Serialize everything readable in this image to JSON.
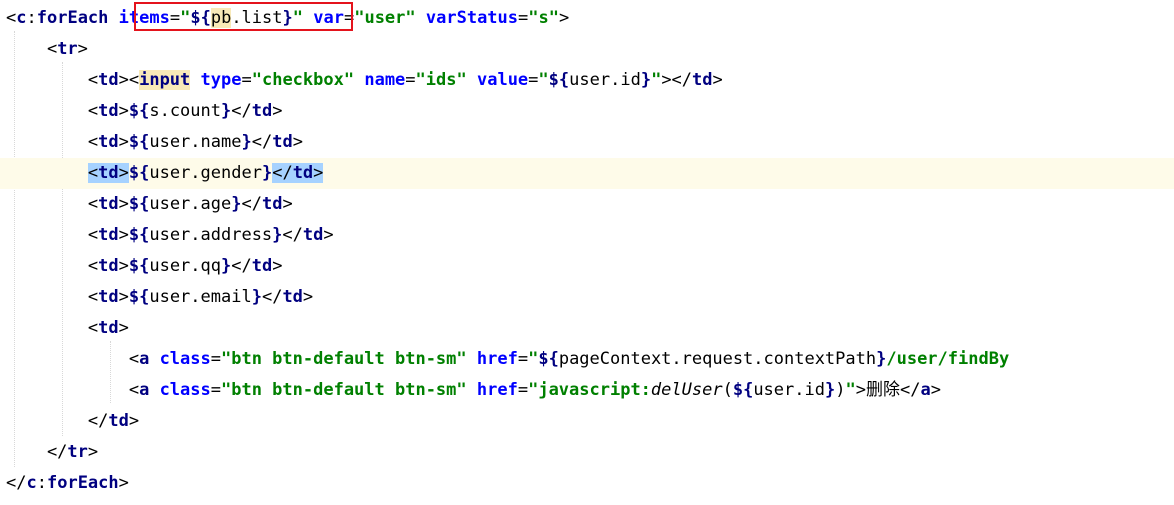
{
  "editor": {
    "highlight_color": "#e4131c",
    "lines": [
      {
        "id": "foreach-open",
        "segments": [
          {
            "t": "<",
            "c": "punct"
          },
          {
            "t": "c",
            "c": "tag"
          },
          {
            "t": ":",
            "c": "punct"
          },
          {
            "t": "forEach",
            "c": "tag"
          },
          {
            "t": " ",
            "c": "punct"
          },
          {
            "t": "items",
            "c": "attr"
          },
          {
            "t": "=",
            "c": "punct"
          },
          {
            "t": "\"",
            "c": "str"
          },
          {
            "t": "${",
            "c": "tag"
          },
          {
            "t": "pb",
            "c": "el",
            "hl": "pb"
          },
          {
            "t": ".list",
            "c": "el"
          },
          {
            "t": "}",
            "c": "tag"
          },
          {
            "t": "\"",
            "c": "str"
          },
          {
            "t": " ",
            "c": "punct"
          },
          {
            "t": "var",
            "c": "attr"
          },
          {
            "t": "=",
            "c": "punct"
          },
          {
            "t": "\"user\"",
            "c": "str"
          },
          {
            "t": " ",
            "c": "punct"
          },
          {
            "t": "varStatus",
            "c": "attr"
          },
          {
            "t": "=",
            "c": "punct"
          },
          {
            "t": "\"s\"",
            "c": "str"
          },
          {
            "t": ">",
            "c": "punct"
          }
        ]
      },
      {
        "id": "tr-open",
        "segments": [
          {
            "t": "    <",
            "c": "punct"
          },
          {
            "t": "tr",
            "c": "tag"
          },
          {
            "t": ">",
            "c": "punct"
          }
        ]
      },
      {
        "id": "td-checkbox",
        "segments": [
          {
            "t": "        <",
            "c": "punct"
          },
          {
            "t": "td",
            "c": "tag"
          },
          {
            "t": "><",
            "c": "punct"
          },
          {
            "t": "input",
            "c": "tag",
            "hl": "pb"
          },
          {
            "t": " ",
            "c": "punct"
          },
          {
            "t": "type",
            "c": "attr"
          },
          {
            "t": "=",
            "c": "punct"
          },
          {
            "t": "\"checkbox\"",
            "c": "str"
          },
          {
            "t": " ",
            "c": "punct"
          },
          {
            "t": "name",
            "c": "attr"
          },
          {
            "t": "=",
            "c": "punct"
          },
          {
            "t": "\"ids\"",
            "c": "str"
          },
          {
            "t": " ",
            "c": "punct"
          },
          {
            "t": "value",
            "c": "attr"
          },
          {
            "t": "=",
            "c": "punct"
          },
          {
            "t": "\"",
            "c": "str"
          },
          {
            "t": "${",
            "c": "tag"
          },
          {
            "t": "user.id",
            "c": "el"
          },
          {
            "t": "}",
            "c": "tag"
          },
          {
            "t": "\"",
            "c": "str"
          },
          {
            "t": "></",
            "c": "punct"
          },
          {
            "t": "td",
            "c": "tag"
          },
          {
            "t": ">",
            "c": "punct"
          }
        ]
      },
      {
        "id": "td-count",
        "segments": [
          {
            "t": "        <",
            "c": "punct"
          },
          {
            "t": "td",
            "c": "tag"
          },
          {
            "t": ">",
            "c": "punct"
          },
          {
            "t": "${",
            "c": "tag"
          },
          {
            "t": "s.count",
            "c": "el"
          },
          {
            "t": "}",
            "c": "tag"
          },
          {
            "t": "</",
            "c": "punct"
          },
          {
            "t": "td",
            "c": "tag"
          },
          {
            "t": ">",
            "c": "punct"
          }
        ]
      },
      {
        "id": "td-name",
        "segments": [
          {
            "t": "        <",
            "c": "punct"
          },
          {
            "t": "td",
            "c": "tag"
          },
          {
            "t": ">",
            "c": "punct"
          },
          {
            "t": "${",
            "c": "tag"
          },
          {
            "t": "user.name",
            "c": "el"
          },
          {
            "t": "}",
            "c": "tag"
          },
          {
            "t": "</",
            "c": "punct"
          },
          {
            "t": "td",
            "c": "tag"
          },
          {
            "t": ">",
            "c": "punct"
          }
        ]
      },
      {
        "id": "td-gender",
        "current": true,
        "segments": [
          {
            "t": "        ",
            "c": "punct"
          },
          {
            "t": "<",
            "c": "punct",
            "hl": "sel"
          },
          {
            "t": "td",
            "c": "tag",
            "hl": "sel"
          },
          {
            "t": ">",
            "c": "punct",
            "hl": "sel"
          },
          {
            "t": "${",
            "c": "tag"
          },
          {
            "t": "user.gender",
            "c": "el"
          },
          {
            "t": "}",
            "c": "tag"
          },
          {
            "t": "</",
            "c": "punct",
            "hl": "sel"
          },
          {
            "t": "td",
            "c": "tag",
            "hl": "sel"
          },
          {
            "t": ">",
            "c": "punct",
            "hl": "sel"
          }
        ]
      },
      {
        "id": "td-age",
        "segments": [
          {
            "t": "        <",
            "c": "punct"
          },
          {
            "t": "td",
            "c": "tag"
          },
          {
            "t": ">",
            "c": "punct"
          },
          {
            "t": "${",
            "c": "tag"
          },
          {
            "t": "user.age",
            "c": "el"
          },
          {
            "t": "}",
            "c": "tag"
          },
          {
            "t": "</",
            "c": "punct"
          },
          {
            "t": "td",
            "c": "tag"
          },
          {
            "t": ">",
            "c": "punct"
          }
        ]
      },
      {
        "id": "td-address",
        "segments": [
          {
            "t": "        <",
            "c": "punct"
          },
          {
            "t": "td",
            "c": "tag"
          },
          {
            "t": ">",
            "c": "punct"
          },
          {
            "t": "${",
            "c": "tag"
          },
          {
            "t": "user.address",
            "c": "el"
          },
          {
            "t": "}",
            "c": "tag"
          },
          {
            "t": "</",
            "c": "punct"
          },
          {
            "t": "td",
            "c": "tag"
          },
          {
            "t": ">",
            "c": "punct"
          }
        ]
      },
      {
        "id": "td-qq",
        "segments": [
          {
            "t": "        <",
            "c": "punct"
          },
          {
            "t": "td",
            "c": "tag"
          },
          {
            "t": ">",
            "c": "punct"
          },
          {
            "t": "${",
            "c": "tag"
          },
          {
            "t": "user.qq",
            "c": "el"
          },
          {
            "t": "}",
            "c": "tag"
          },
          {
            "t": "</",
            "c": "punct"
          },
          {
            "t": "td",
            "c": "tag"
          },
          {
            "t": ">",
            "c": "punct"
          }
        ]
      },
      {
        "id": "td-email",
        "segments": [
          {
            "t": "        <",
            "c": "punct"
          },
          {
            "t": "td",
            "c": "tag"
          },
          {
            "t": ">",
            "c": "punct"
          },
          {
            "t": "${",
            "c": "tag"
          },
          {
            "t": "user.email",
            "c": "el"
          },
          {
            "t": "}",
            "c": "tag"
          },
          {
            "t": "</",
            "c": "punct"
          },
          {
            "t": "td",
            "c": "tag"
          },
          {
            "t": ">",
            "c": "punct"
          }
        ]
      },
      {
        "id": "td-open",
        "segments": [
          {
            "t": "        <",
            "c": "punct"
          },
          {
            "t": "td",
            "c": "tag"
          },
          {
            "t": ">",
            "c": "punct"
          }
        ]
      },
      {
        "id": "a-edit",
        "segments": [
          {
            "t": "            <",
            "c": "punct"
          },
          {
            "t": "a",
            "c": "tag"
          },
          {
            "t": " ",
            "c": "punct"
          },
          {
            "t": "class",
            "c": "attr"
          },
          {
            "t": "=",
            "c": "punct"
          },
          {
            "t": "\"btn btn-default btn-sm\"",
            "c": "str"
          },
          {
            "t": " ",
            "c": "punct"
          },
          {
            "t": "href",
            "c": "attr"
          },
          {
            "t": "=",
            "c": "punct"
          },
          {
            "t": "\"",
            "c": "str"
          },
          {
            "t": "${",
            "c": "tag"
          },
          {
            "t": "pageContext.request.contextPath",
            "c": "el"
          },
          {
            "t": "}",
            "c": "tag"
          },
          {
            "t": "/user/findBy",
            "c": "str"
          }
        ]
      },
      {
        "id": "a-delete",
        "segments": [
          {
            "t": "            <",
            "c": "punct"
          },
          {
            "t": "a",
            "c": "tag"
          },
          {
            "t": " ",
            "c": "punct"
          },
          {
            "t": "class",
            "c": "attr"
          },
          {
            "t": "=",
            "c": "punct"
          },
          {
            "t": "\"btn btn-default btn-sm\"",
            "c": "str"
          },
          {
            "t": " ",
            "c": "punct"
          },
          {
            "t": "href",
            "c": "attr"
          },
          {
            "t": "=",
            "c": "punct"
          },
          {
            "t": "\"javascript:",
            "c": "str"
          },
          {
            "t": "delUser",
            "c": "ital"
          },
          {
            "t": "(",
            "c": "punct"
          },
          {
            "t": "${",
            "c": "tag"
          },
          {
            "t": "user.id",
            "c": "el"
          },
          {
            "t": "}",
            "c": "tag"
          },
          {
            "t": ")",
            "c": "punct"
          },
          {
            "t": "\"",
            "c": "str"
          },
          {
            "t": ">删除</",
            "c": "punct"
          },
          {
            "t": "a",
            "c": "tag"
          },
          {
            "t": ">",
            "c": "punct"
          }
        ]
      },
      {
        "id": "td-close",
        "segments": [
          {
            "t": "        </",
            "c": "punct"
          },
          {
            "t": "td",
            "c": "tag"
          },
          {
            "t": ">",
            "c": "punct"
          }
        ]
      },
      {
        "id": "tr-close",
        "segments": [
          {
            "t": "    </",
            "c": "punct"
          },
          {
            "t": "tr",
            "c": "tag"
          },
          {
            "t": ">",
            "c": "punct"
          }
        ]
      },
      {
        "id": "foreach-close",
        "segments": [
          {
            "t": "</",
            "c": "punct"
          },
          {
            "t": "c",
            "c": "tag"
          },
          {
            "t": ":",
            "c": "punct"
          },
          {
            "t": "forEach",
            "c": "tag"
          },
          {
            "t": ">",
            "c": "punct"
          }
        ]
      }
    ]
  }
}
